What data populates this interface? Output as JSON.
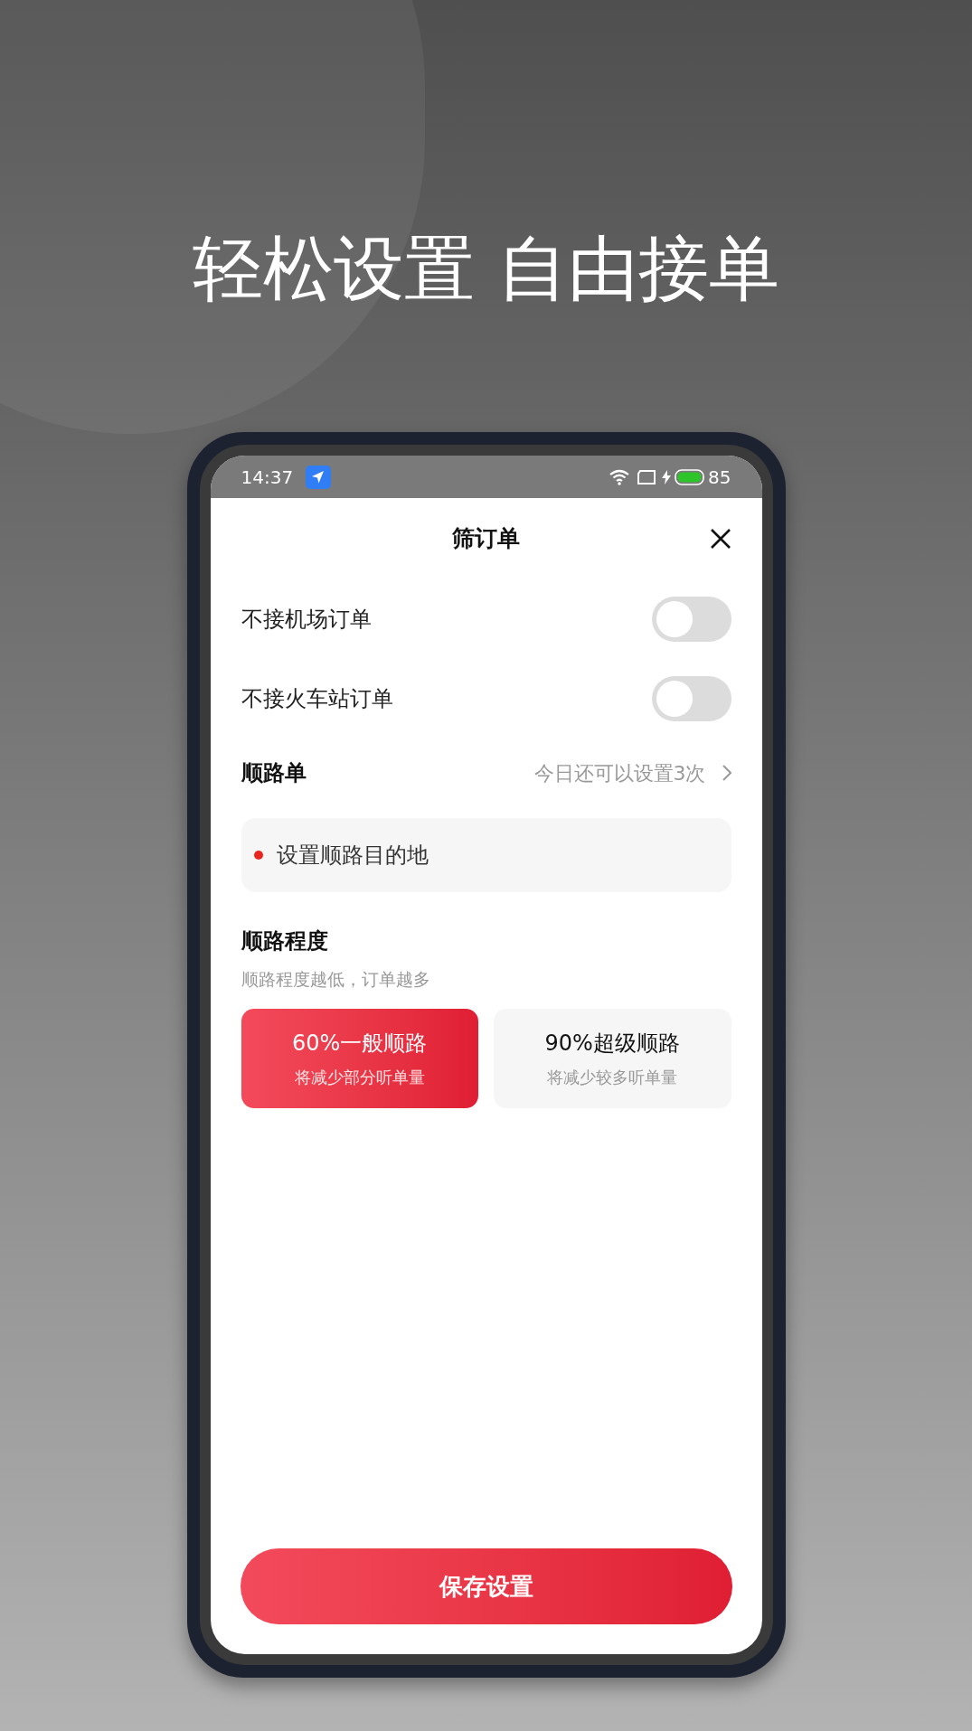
{
  "headline": "轻松设置 自由接单",
  "status_bar": {
    "time": "14:37",
    "battery": "85"
  },
  "dialog": {
    "title": "筛订单",
    "toggles": [
      {
        "label": "不接机场订单",
        "on": false
      },
      {
        "label": "不接火车站订单",
        "on": false
      }
    ],
    "route_section": {
      "title": "顺路单",
      "remaining": "今日还可以设置3次",
      "destination_placeholder": "设置顺路目的地"
    },
    "degree_section": {
      "title": "顺路程度",
      "hint": "顺路程度越低，订单越多",
      "options": [
        {
          "label": "60%一般顺路",
          "sub": "将减少部分听单量",
          "selected": true
        },
        {
          "label": "90%超级顺路",
          "sub": "将减少较多听单量",
          "selected": false
        }
      ]
    },
    "save_button": "保存设置"
  }
}
